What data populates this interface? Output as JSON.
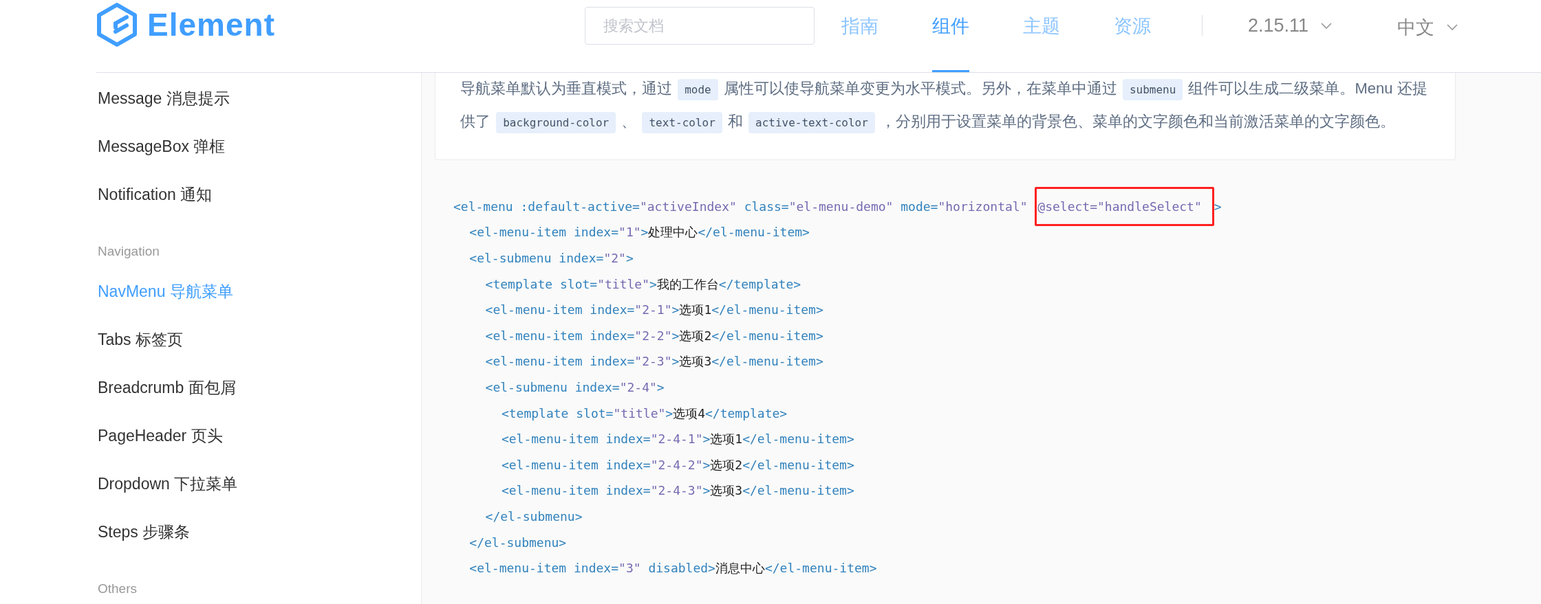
{
  "header": {
    "logo_text": "Element",
    "search": {
      "placeholder": "搜索文档"
    },
    "nav": [
      {
        "label": "指南",
        "selected": false
      },
      {
        "label": "组件",
        "selected": true
      },
      {
        "label": "主题",
        "selected": false
      },
      {
        "label": "资源",
        "selected": false
      }
    ],
    "version": "2.15.11",
    "language": "中文"
  },
  "sidebar": {
    "items": [
      {
        "kind": "item",
        "label": "Message 消息提示",
        "selected": false
      },
      {
        "kind": "item",
        "label": "MessageBox 弹框",
        "selected": false
      },
      {
        "kind": "item",
        "label": "Notification 通知",
        "selected": false
      },
      {
        "kind": "group",
        "label": "Navigation"
      },
      {
        "kind": "item",
        "label": "NavMenu 导航菜单",
        "selected": true
      },
      {
        "kind": "item",
        "label": "Tabs 标签页",
        "selected": false
      },
      {
        "kind": "item",
        "label": "Breadcrumb 面包屑",
        "selected": false
      },
      {
        "kind": "item",
        "label": "PageHeader 页头",
        "selected": false
      },
      {
        "kind": "item",
        "label": "Dropdown 下拉菜单",
        "selected": false
      },
      {
        "kind": "item",
        "label": "Steps 步骤条",
        "selected": false
      },
      {
        "kind": "group",
        "label": "Others"
      }
    ]
  },
  "description": [
    {
      "kind": "text",
      "s": "导航菜单默认为垂直模式，通过 "
    },
    {
      "kind": "code",
      "s": "mode"
    },
    {
      "kind": "text",
      "s": " 属性可以使导航菜单变更为水平模式。另外，在菜单中通过 "
    },
    {
      "kind": "code",
      "s": "submenu"
    },
    {
      "kind": "text",
      "s": " 组件可以生成二级菜单。Menu 还提供了 "
    },
    {
      "kind": "code",
      "s": "background-color"
    },
    {
      "kind": "text",
      "s": " 、 "
    },
    {
      "kind": "code",
      "s": "text-color"
    },
    {
      "kind": "text",
      "s": " 和 "
    },
    {
      "kind": "code",
      "s": "active-text-color"
    },
    {
      "kind": "text",
      "s": " ，分别用于设置菜单的背景色、菜单的文字颜色和当前激活菜单的文字颜色。"
    }
  ],
  "code": [
    {
      "tokens": [
        {
          "kind": "code",
          "s": "<el-menu :default-active="
        },
        {
          "kind": "string",
          "s": "\"activeIndex\""
        },
        {
          "kind": "code",
          "s": " class="
        },
        {
          "kind": "string",
          "s": "\"el-menu-demo\""
        },
        {
          "kind": "code",
          "s": " mode="
        },
        {
          "kind": "string",
          "s": "\"horizontal\""
        }
      ],
      "boxed_tokens": [
        {
          "kind": "string",
          "s": "@select=\"handleSelect\""
        }
      ],
      "after_tokens": [
        {
          "kind": "code",
          "s": ">"
        }
      ],
      "children": [
        {
          "tokens": [
            {
              "kind": "code",
              "s": "<el-menu-item index="
            },
            {
              "kind": "string",
              "s": "\"1\""
            },
            {
              "kind": "code",
              "s": ">"
            },
            {
              "kind": "text",
              "s": "处理中心"
            },
            {
              "kind": "code",
              "s": "</el-menu-item>"
            }
          ]
        },
        {
          "tokens": [
            {
              "kind": "code",
              "s": "<el-submenu index="
            },
            {
              "kind": "string",
              "s": "\"2\""
            },
            {
              "kind": "code",
              "s": ">"
            }
          ],
          "children": [
            {
              "tokens": [
                {
                  "kind": "code",
                  "s": "<template slot="
                },
                {
                  "kind": "string",
                  "s": "\"title\""
                },
                {
                  "kind": "code",
                  "s": ">"
                },
                {
                  "kind": "text",
                  "s": "我的工作台"
                },
                {
                  "kind": "code",
                  "s": "</template>"
                }
              ]
            },
            {
              "tokens": [
                {
                  "kind": "code",
                  "s": "<el-menu-item index="
                },
                {
                  "kind": "string",
                  "s": "\"2-1\""
                },
                {
                  "kind": "code",
                  "s": ">"
                },
                {
                  "kind": "text",
                  "s": "选项1"
                },
                {
                  "kind": "code",
                  "s": "</el-menu-item>"
                }
              ]
            },
            {
              "tokens": [
                {
                  "kind": "code",
                  "s": "<el-menu-item index="
                },
                {
                  "kind": "string",
                  "s": "\"2-2\""
                },
                {
                  "kind": "code",
                  "s": ">"
                },
                {
                  "kind": "text",
                  "s": "选项2"
                },
                {
                  "kind": "code",
                  "s": "</el-menu-item>"
                }
              ]
            },
            {
              "tokens": [
                {
                  "kind": "code",
                  "s": "<el-menu-item index="
                },
                {
                  "kind": "string",
                  "s": "\"2-3\""
                },
                {
                  "kind": "code",
                  "s": ">"
                },
                {
                  "kind": "text",
                  "s": "选项3"
                },
                {
                  "kind": "code",
                  "s": "</el-menu-item>"
                }
              ]
            },
            {
              "tokens": [
                {
                  "kind": "code",
                  "s": "<el-submenu index="
                },
                {
                  "kind": "string",
                  "s": "\"2-4\""
                },
                {
                  "kind": "code",
                  "s": ">"
                }
              ],
              "children": [
                {
                  "tokens": [
                    {
                      "kind": "code",
                      "s": "<template slot="
                    },
                    {
                      "kind": "string",
                      "s": "\"title\""
                    },
                    {
                      "kind": "code",
                      "s": ">"
                    },
                    {
                      "kind": "text",
                      "s": "选项4"
                    },
                    {
                      "kind": "code",
                      "s": "</template>"
                    }
                  ]
                },
                {
                  "tokens": [
                    {
                      "kind": "code",
                      "s": "<el-menu-item index="
                    },
                    {
                      "kind": "string",
                      "s": "\"2-4-1\""
                    },
                    {
                      "kind": "code",
                      "s": ">"
                    },
                    {
                      "kind": "text",
                      "s": "选项1"
                    },
                    {
                      "kind": "code",
                      "s": "</el-menu-item>"
                    }
                  ]
                },
                {
                  "tokens": [
                    {
                      "kind": "code",
                      "s": "<el-menu-item index="
                    },
                    {
                      "kind": "string",
                      "s": "\"2-4-2\""
                    },
                    {
                      "kind": "code",
                      "s": ">"
                    },
                    {
                      "kind": "text",
                      "s": "选项2"
                    },
                    {
                      "kind": "code",
                      "s": "</el-menu-item>"
                    }
                  ]
                },
                {
                  "tokens": [
                    {
                      "kind": "code",
                      "s": "<el-menu-item index="
                    },
                    {
                      "kind": "string",
                      "s": "\"2-4-3\""
                    },
                    {
                      "kind": "code",
                      "s": ">"
                    },
                    {
                      "kind": "text",
                      "s": "选项3"
                    },
                    {
                      "kind": "code",
                      "s": "</el-menu-item>"
                    }
                  ]
                }
              ]
            },
            {
              "tokens": [
                {
                  "kind": "code",
                  "s": "</el-submenu>"
                }
              ]
            }
          ]
        },
        {
          "tokens": [
            {
              "kind": "code",
              "s": "</el-submenu>"
            }
          ]
        },
        {
          "tokens": [
            {
              "kind": "code",
              "s": "<el-menu-item index="
            },
            {
              "kind": "string",
              "s": "\"3\""
            },
            {
              "kind": "code",
              "s": " disabled>"
            },
            {
              "kind": "text",
              "s": "消息中心"
            },
            {
              "kind": "code",
              "s": "</el-menu-item>"
            }
          ]
        }
      ]
    }
  ]
}
